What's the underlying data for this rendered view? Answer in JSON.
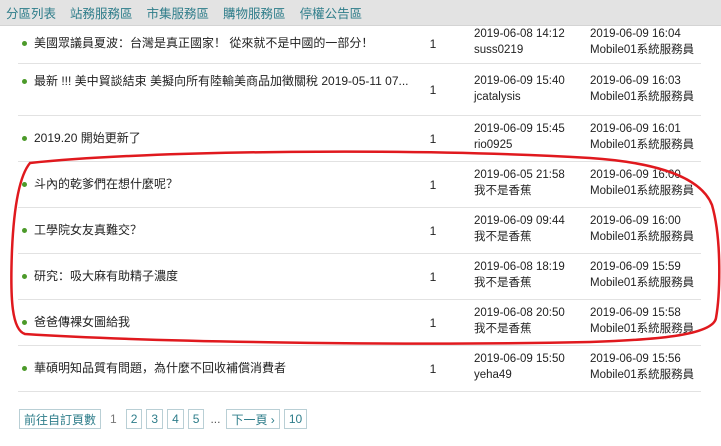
{
  "nav": {
    "items": [
      {
        "label": "分區列表"
      },
      {
        "label": "站務服務區"
      },
      {
        "label": "市集服務區"
      },
      {
        "label": "購物服務區"
      },
      {
        "label": "停權公告區"
      }
    ]
  },
  "threads": [
    {
      "title": "美國眾議員夏波：台灣是真正國家！ 從來就不是中國的一部分！",
      "replies": "1",
      "posted": "2019-06-08 14:12",
      "author": "suss0219",
      "last_time": "2019-06-09 16:04",
      "last_user": "Mobile01系統服務員"
    },
    {
      "title": "最新 !!! 美中貿談結束 美擬向所有陸輸美商品加徵關稅 2019-05-11 07...",
      "replies": "1",
      "posted": "2019-06-09 15:40",
      "author": "jcatalysis",
      "last_time": "2019-06-09 16:03",
      "last_user": "Mobile01系統服務員"
    },
    {
      "title": "2019.20 開始更新了",
      "replies": "1",
      "posted": "2019-06-09 15:45",
      "author": "rio0925",
      "last_time": "2019-06-09 16:01",
      "last_user": "Mobile01系統服務員"
    },
    {
      "title": "斗內的乾爹們在想什麼呢？",
      "replies": "1",
      "posted": "2019-06-05 21:58",
      "author": "我不是香蕉",
      "last_time": "2019-06-09 16:00",
      "last_user": "Mobile01系統服務員"
    },
    {
      "title": "工學院女友真難交？",
      "replies": "1",
      "posted": "2019-06-09 09:44",
      "author": "我不是香蕉",
      "last_time": "2019-06-09 16:00",
      "last_user": "Mobile01系統服務員"
    },
    {
      "title": "研究：吸大麻有助精子濃度",
      "replies": "1",
      "posted": "2019-06-08 18:19",
      "author": "我不是香蕉",
      "last_time": "2019-06-09 15:59",
      "last_user": "Mobile01系統服務員"
    },
    {
      "title": "爸爸傳裸女圖給我",
      "replies": "1",
      "posted": "2019-06-08 20:50",
      "author": "我不是香蕉",
      "last_time": "2019-06-09 15:58",
      "last_user": "Mobile01系統服務員"
    },
    {
      "title": "華碩明知品質有問題，為什麼不回收補償消費者",
      "replies": "1",
      "posted": "2019-06-09 15:50",
      "author": "yeha49",
      "last_time": "2019-06-09 15:56",
      "last_user": "Mobile01系統服務員"
    }
  ],
  "pager": {
    "custom_page": "前往自訂頁數",
    "pages": [
      "1",
      "2",
      "3",
      "4",
      "5"
    ],
    "ellipsis": "...",
    "next": "下一頁 ›",
    "last": "10"
  },
  "colors": {
    "link": "#2e7d8a",
    "bullet": "#4c9a2a",
    "annotation": "#e0191e"
  }
}
